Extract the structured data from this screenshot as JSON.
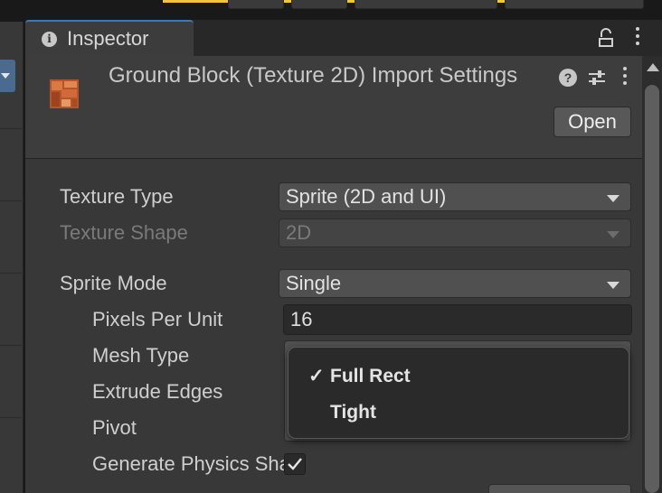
{
  "window": {
    "tab_title": "Inspector",
    "tab_icon": "info-icon"
  },
  "header": {
    "title": "Ground Block (Texture 2D) Import Settings",
    "open_label": "Open",
    "icons": [
      "help-icon",
      "preset-icon",
      "menu-icon",
      "lock-icon"
    ]
  },
  "properties": {
    "texture_type": {
      "label": "Texture Type",
      "value": "Sprite (2D and UI)"
    },
    "texture_shape": {
      "label": "Texture Shape",
      "value": "2D",
      "disabled": true
    },
    "sprite_mode": {
      "label": "Sprite Mode",
      "value": "Single"
    },
    "pixels_per_unit": {
      "label": "Pixels Per Unit",
      "value": "16"
    },
    "mesh_type": {
      "label": "Mesh Type"
    },
    "extrude_edges": {
      "label": "Extrude Edges"
    },
    "pivot": {
      "label": "Pivot"
    },
    "generate_physics": {
      "label": "Generate Physics Shape",
      "checked": true
    }
  },
  "mesh_type_popup": {
    "items": [
      {
        "label": "Full Rect",
        "checked": true,
        "check_mark": "✓"
      },
      {
        "label": "Tight",
        "checked": false,
        "check_mark": ""
      }
    ]
  },
  "colors": {
    "panel_bg": "#383838",
    "tab_accent": "#3a79bb",
    "asset_icon": "#c65a2a"
  }
}
